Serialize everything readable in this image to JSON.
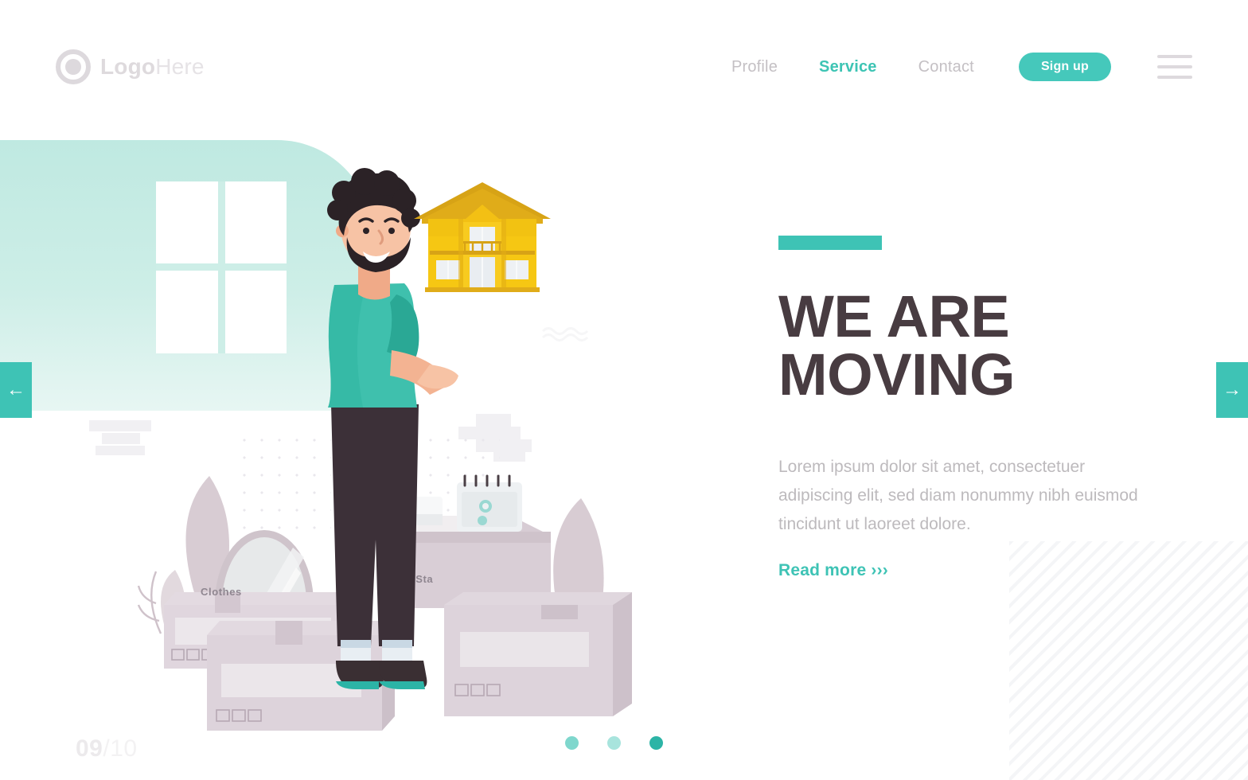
{
  "header": {
    "logo": {
      "bold": "Logo",
      "light": "Here",
      "icon": "circle-logo-icon"
    },
    "nav": [
      {
        "label": "Profile",
        "active": false
      },
      {
        "label": "Service",
        "active": true
      },
      {
        "label": "Contact",
        "active": false
      }
    ],
    "signup_label": "Sign up",
    "menu_icon": "hamburger-menu-icon"
  },
  "hero": {
    "accent_color": "#3ec3b5",
    "headline_line1": "WE ARE",
    "headline_line2": "MOVING",
    "headline_color": "#483c41",
    "body": "Lorem ipsum dolor sit amet, consectetuer adipiscing elit, sed diam nonummy nibh euismod tincidunt ut laoreet dolore.",
    "read_more": "Read more ›››"
  },
  "carousel": {
    "prev_icon": "arrow-left-icon",
    "next_icon": "arrow-right-icon",
    "prev_label": "←",
    "next_label": "→",
    "current": "09",
    "total": "/10",
    "dots": 3,
    "active_dot": 3
  },
  "illustration": {
    "alt": "man holding a small yellow house beside moving boxes",
    "box_labels": [
      "Clothes",
      "& Sta"
    ],
    "shirt_color": "#3fc0ad",
    "house_wall_color": "#f6c713",
    "house_roof_color": "#d7a316",
    "panel_color": "#cdeee7"
  }
}
